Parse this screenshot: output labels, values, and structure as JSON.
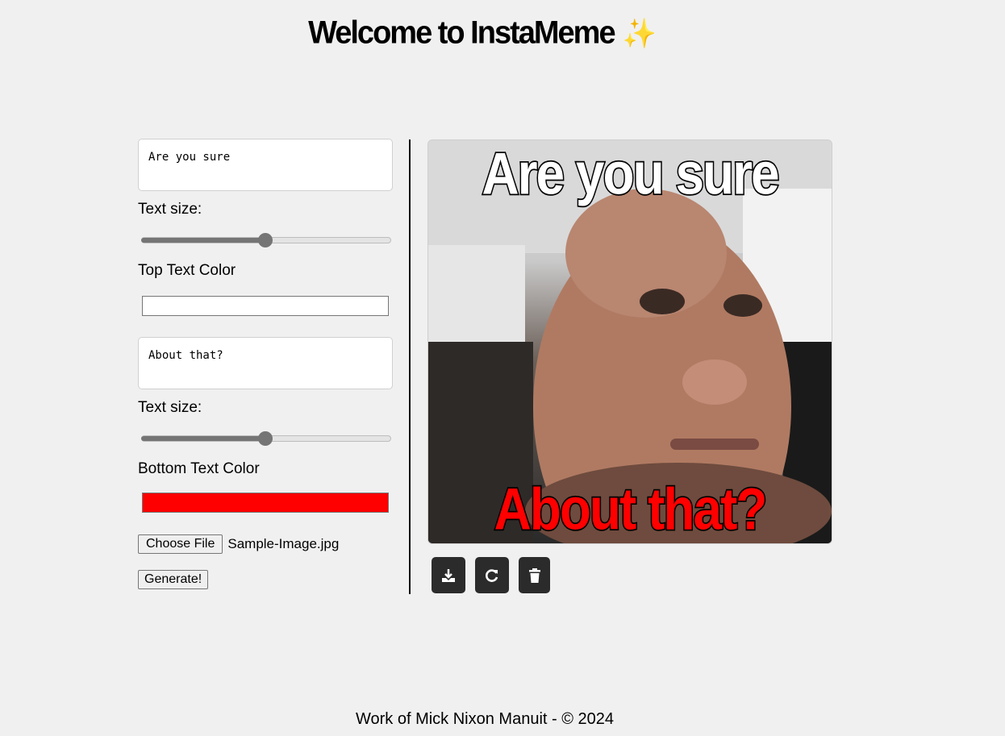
{
  "header": {
    "title": "Welcome to InstaMeme",
    "emoji": "✨"
  },
  "top": {
    "text": "Are you sure",
    "size_label": "Text size:",
    "size_value": 0.5,
    "color_label": "Top Text Color",
    "color": "#ffffff"
  },
  "bottom": {
    "text": "About that?",
    "size_label": "Text size:",
    "size_value": 0.5,
    "color_label": "Bottom Text Color",
    "color": "#ff0000"
  },
  "file": {
    "button_label": "Choose File",
    "file_name": "Sample-Image.jpg"
  },
  "generate_label": "Generate!",
  "actions": [
    {
      "name": "download-icon"
    },
    {
      "name": "refresh-icon"
    },
    {
      "name": "trash-icon"
    }
  ],
  "footer": {
    "text": "Work of Mick Nixon Manuit - © 2024"
  }
}
